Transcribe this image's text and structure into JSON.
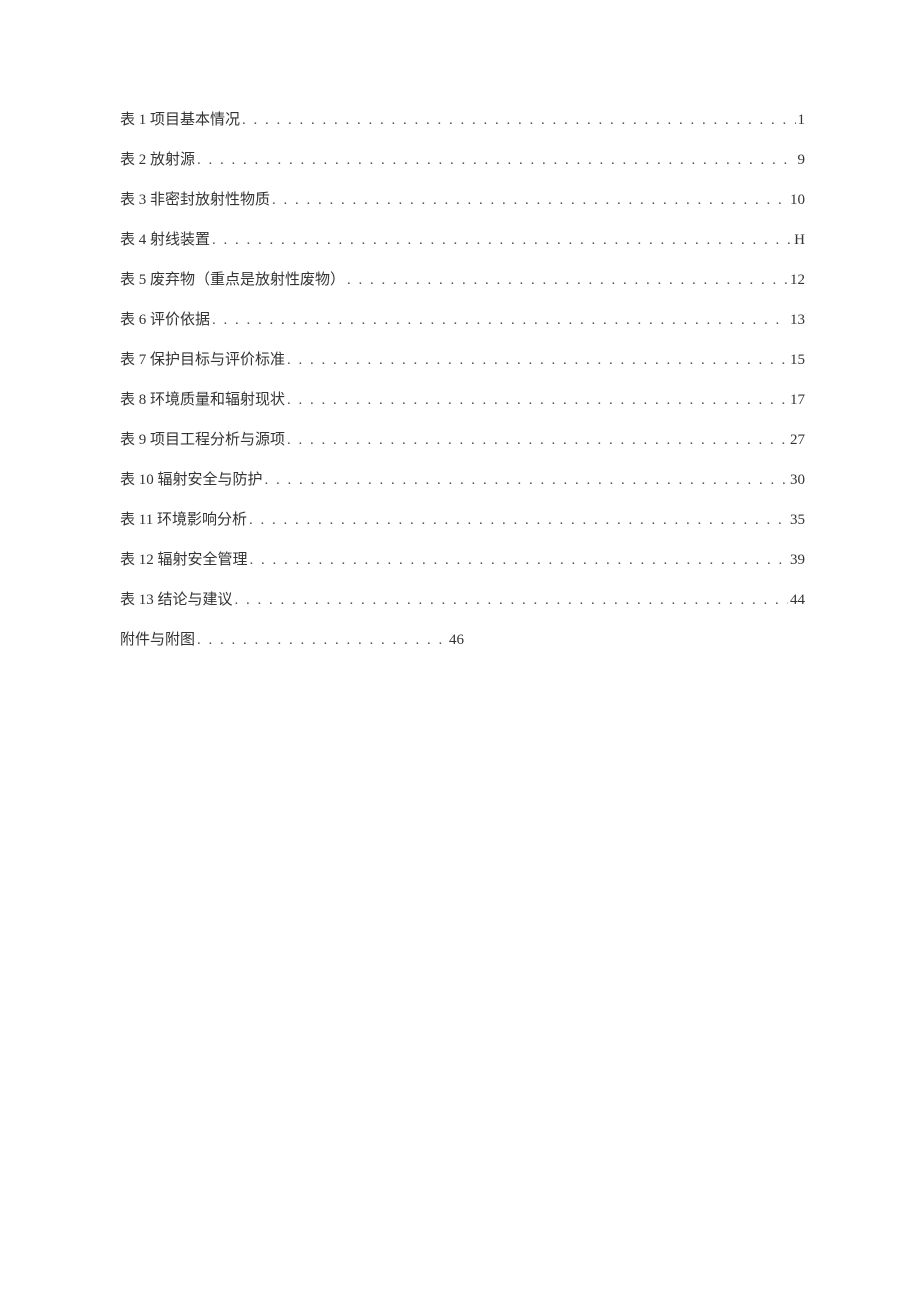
{
  "toc": {
    "entries": [
      {
        "label": "表 1 项目基本情况",
        "page": "1",
        "short": false
      },
      {
        "label": "表 2 放射源",
        "page": "9",
        "short": false
      },
      {
        "label": "表 3 非密封放射性物质",
        "page": "10",
        "short": false
      },
      {
        "label": "表 4 射线装置",
        "page": "H",
        "short": false
      },
      {
        "label": "表 5 废弃物（重点是放射性废物）",
        "page": "12",
        "short": false
      },
      {
        "label": "表 6 评价依据",
        "page": "13",
        "short": false
      },
      {
        "label": "表 7 保护目标与评价标准",
        "page": "15",
        "short": false
      },
      {
        "label": "表 8 环境质量和辐射现状",
        "page": "17",
        "short": false
      },
      {
        "label": "表 9 项目工程分析与源项",
        "page": "27",
        "short": false
      },
      {
        "label": "表 10 辐射安全与防护",
        "page": "30",
        "short": false
      },
      {
        "label": "表 11 环境影响分析",
        "page": "35",
        "short": false
      },
      {
        "label": "表 12 辐射安全管理",
        "page": "39",
        "short": false
      },
      {
        "label": "表 13 结论与建议",
        "page": "44",
        "short": false
      },
      {
        "label": "附件与附图",
        "page": "46",
        "short": true
      }
    ]
  }
}
